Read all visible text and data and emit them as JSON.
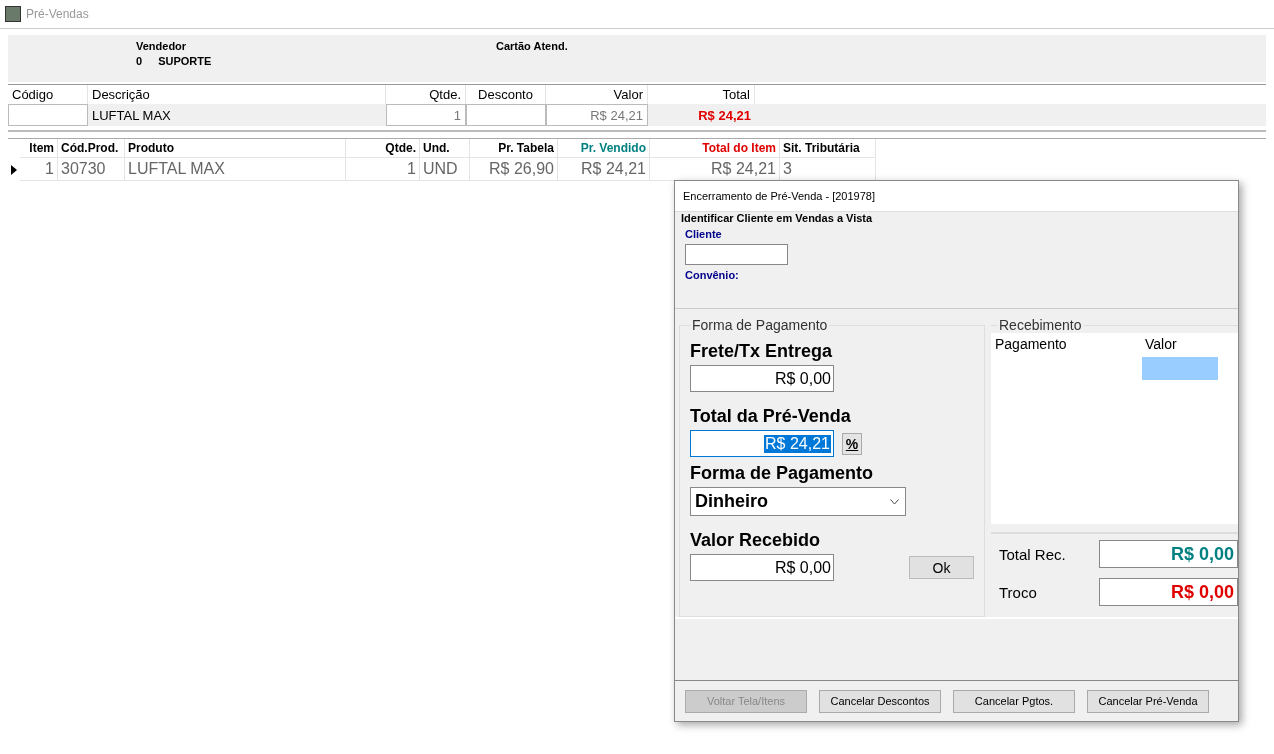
{
  "window": {
    "title": "Pré-Vendas"
  },
  "header": {
    "seller_label": "Vendedor",
    "seller_code": "0",
    "seller_name": "SUPORTE",
    "card_label": "Cartão Atend."
  },
  "entry": {
    "columns": [
      "Código",
      "Descrição",
      "Qtde.",
      "Desconto",
      "Valor",
      "Total"
    ],
    "values": [
      {
        "kind": "field"
      },
      {
        "kind": "text",
        "text": "LUFTAL MAX"
      },
      {
        "kind": "field",
        "text": "1"
      },
      {
        "kind": "field"
      },
      {
        "kind": "field",
        "text": "R$ 24,21"
      },
      {
        "kind": "total",
        "text": "R$ 24,21"
      }
    ]
  },
  "table": {
    "columns": [
      {
        "label": "Item",
        "color": "#000000"
      },
      {
        "label": "Cód.Prod.",
        "color": "#000000"
      },
      {
        "label": "Produto",
        "color": "#000000"
      },
      {
        "label": "Qtde.",
        "color": "#000000"
      },
      {
        "label": "Und.",
        "color": "#000000"
      },
      {
        "label": "Pr. Tabela",
        "color": "#000000"
      },
      {
        "label": "Pr. Vendido",
        "color": "#008080"
      },
      {
        "label": "Total do Item",
        "color": "#e00000"
      },
      {
        "label": "Sit. Tributária",
        "color": "#000000"
      }
    ],
    "rows": [
      {
        "selected": true,
        "cells": [
          "1",
          "30730",
          "LUFTAL MAX",
          "1",
          "UND",
          "R$ 26,90",
          "R$ 24,21",
          "R$ 24,21",
          "3"
        ]
      }
    ]
  },
  "dialog": {
    "title": "Encerramento de Pré-Venda  -  [201978]",
    "client_section": "Identificar Cliente em Vendas a Vista",
    "client_label": "Cliente",
    "agreement_label": "Convênio:",
    "payment_group": "Forma de Pagamento",
    "freight_label": "Frete/Tx Entrega",
    "freight_value": "R$ 0,00",
    "total_label": "Total da Pré-Venda",
    "total_value": "R$ 24,21",
    "total_selected": true,
    "percent_button": "%",
    "method_label": "Forma de Pagamento",
    "method_value": "Dinheiro",
    "received_label": "Valor Recebido",
    "received_value": "R$ 0,00",
    "ok_button": "Ok",
    "receipt_group": "Recebimento",
    "receipt_columns": [
      "Pagamento",
      "Valor"
    ],
    "total_rec_label": "Total Rec.",
    "total_rec_value": "R$ 0,00",
    "change_label": "Troco",
    "change_value": "R$ 0,00",
    "buttons": [
      {
        "label": "Voltar Tela/Itens",
        "disabled": true
      },
      {
        "label": "Cancelar Descontos",
        "disabled": false
      },
      {
        "label": "Cancelar Pgtos.",
        "disabled": false
      },
      {
        "label": "Cancelar Pré-Venda",
        "disabled": false
      }
    ]
  }
}
